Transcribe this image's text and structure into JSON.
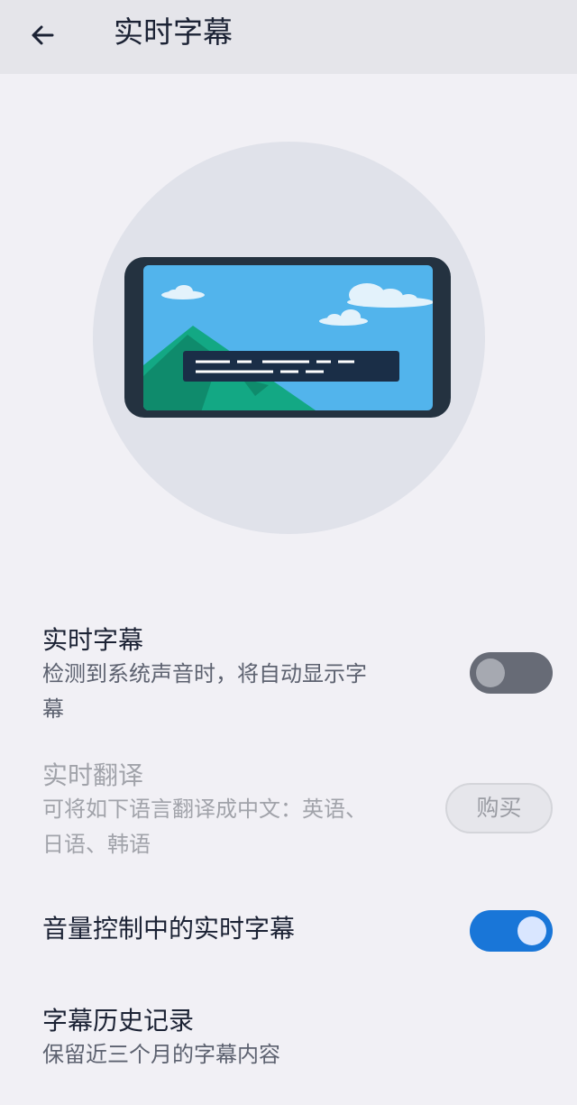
{
  "header": {
    "title": "实时字幕"
  },
  "settings": {
    "live_caption": {
      "title": "实时字幕",
      "description_line1": "检测到系统声音时，将自动显示字",
      "description_line2": "幕",
      "toggle": "off"
    },
    "live_translate": {
      "title": "实时翻译",
      "description_line1": "可将如下语言翻译成中文：英语、",
      "description_line2": "日语、韩语",
      "button_label": "购买",
      "state": "disabled"
    },
    "volume_control_caption": {
      "title": "音量控制中的实时字幕",
      "toggle": "on"
    },
    "caption_history": {
      "title": "字幕历史记录",
      "description": "保留近三个月的字幕内容"
    }
  },
  "colors": {
    "accent": "#1976d8",
    "background": "#f1f0f5",
    "header_background": "#e5e5ea",
    "illustration_circle": "#e0e2ea",
    "sky": "#52b4ec",
    "mountain": "#13a884",
    "device_frame": "#243240"
  }
}
